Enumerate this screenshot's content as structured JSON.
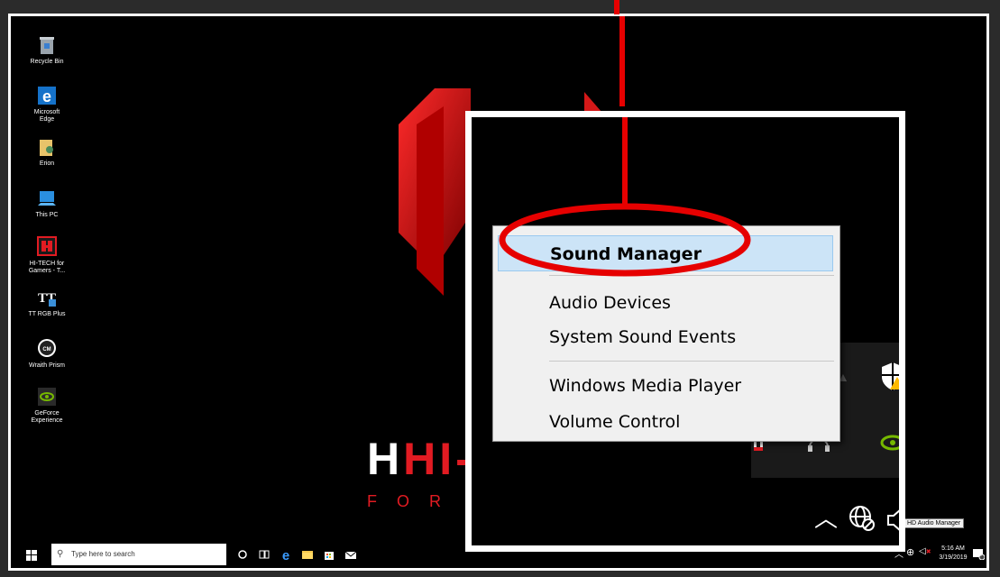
{
  "desktop": {
    "icons": [
      {
        "label": "Recycle Bin",
        "icon": "recycle-bin-icon"
      },
      {
        "label": "Microsoft Edge",
        "icon": "edge-icon"
      },
      {
        "label": "Erion",
        "icon": "user-folder-icon"
      },
      {
        "label": "This PC",
        "icon": "computer-icon"
      },
      {
        "label": "HI-TECH for Gamers - T...",
        "icon": "hitech-app-icon"
      },
      {
        "label": "TT RGB Plus",
        "icon": "tt-rgb-icon"
      },
      {
        "label": "Wraith Prism",
        "icon": "cooler-master-icon"
      },
      {
        "label": "GeForce Experience",
        "icon": "nvidia-icon"
      }
    ],
    "wallpaper_text": {
      "brand": "HI-",
      "sub": "FOR"
    }
  },
  "context_menu": {
    "items": [
      {
        "label": "Sound Manager",
        "selected": true
      },
      {
        "label": "Audio Devices"
      },
      {
        "label": "System Sound Events"
      },
      {
        "label": "Windows Media Player"
      },
      {
        "label": "Volume Control"
      }
    ]
  },
  "tooltip": {
    "text": "HD Audio Manager"
  },
  "taskbar": {
    "search_placeholder": "Type here to search",
    "time": "5:16 AM",
    "date": "3/19/2019",
    "notification_count": "3"
  },
  "colors": {
    "annotation": "#e60000",
    "highlight": "#cce4f7",
    "brand_red": "#e11b22"
  }
}
